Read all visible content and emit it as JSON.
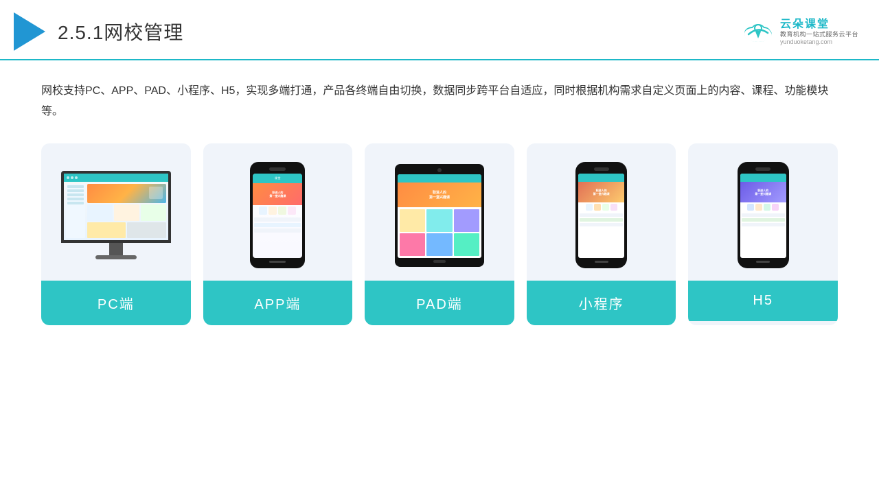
{
  "header": {
    "title_prefix": "2.5.1",
    "title_main": "网校管理",
    "brand_name": "云朵课堂",
    "brand_sub": "教育机构一站",
    "brand_sub2": "式服务云平台",
    "brand_url": "yunduoketang.com"
  },
  "description": "网校支持PC、APP、PAD、小程序、H5，实现多端打通，产品各终端自由切换，数据同步跨平台自适应，同时根据机构需求自定义页面上的内容、课程、功能模块等。",
  "cards": [
    {
      "id": "pc",
      "label": "PC端"
    },
    {
      "id": "app",
      "label": "APP端"
    },
    {
      "id": "pad",
      "label": "PAD端"
    },
    {
      "id": "miniprogram",
      "label": "小程序"
    },
    {
      "id": "h5",
      "label": "H5"
    }
  ],
  "accent_color": "#2ec5c5",
  "bg_color": "#f0f4fa"
}
